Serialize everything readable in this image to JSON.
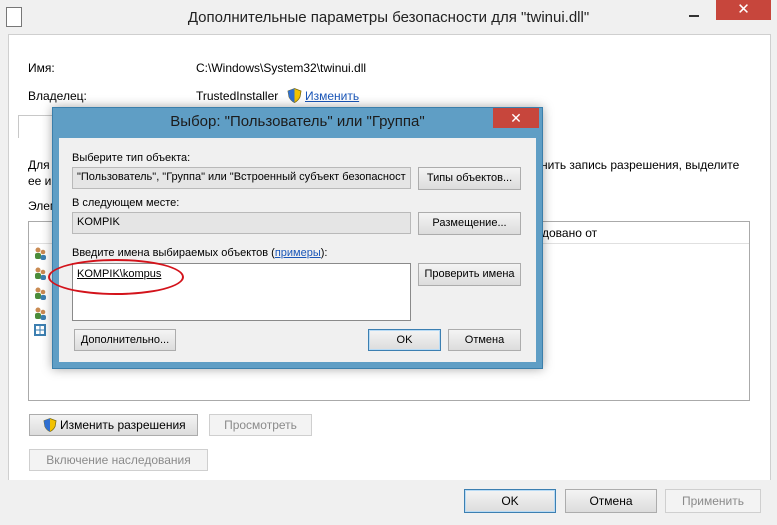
{
  "outer_window": {
    "title": "Дополнительные параметры безопасности  для \"twinui.dll\"",
    "close_glyph": "✕",
    "name_label": "Имя:",
    "name_value": "C:\\Windows\\System32\\twinui.dll",
    "owner_label": "Владелец:",
    "owner_value": "TrustedInstaller",
    "owner_change_link": "Изменить",
    "desc_left_line1": "Для",
    "desc_left_line2": "ее и",
    "desc_right": "нить запись разрешения, выделите",
    "desc_right_line2": "",
    "entries_label": "Элем",
    "inherited_from_header": "довано от",
    "buttons": {
      "change_permissions": "Изменить разрешения",
      "view": "Просмотреть",
      "enable_inheritance": "Включение наследования",
      "ok": "OK",
      "cancel": "Отмена",
      "apply": "Применить"
    }
  },
  "modal": {
    "title": "Выбор: \"Пользователь\" или \"Группа\"",
    "close_glyph": "✕",
    "object_type_label": "Выберите тип объекта:",
    "object_type_value": "\"Пользователь\", \"Группа\" или \"Встроенный субъект безопасност",
    "object_types_button": "Типы объектов...",
    "location_label": "В следующем месте:",
    "location_value": "KOMPIK",
    "locations_button": "Размещение...",
    "names_label_prefix": "Введите имена выбираемых объектов (",
    "names_label_link": "примеры",
    "names_label_suffix": "):",
    "names_value": "KOMPIK\\kompus",
    "check_names_button": "Проверить имена",
    "advanced_button": "Дополнительно...",
    "ok_button": "OK",
    "cancel_button": "Отмена"
  },
  "colors": {
    "modal_frame": "#5f9ec5",
    "close_red": "#c7463c",
    "annotation_red": "#d3131b",
    "link_blue": "#1a56b8"
  }
}
